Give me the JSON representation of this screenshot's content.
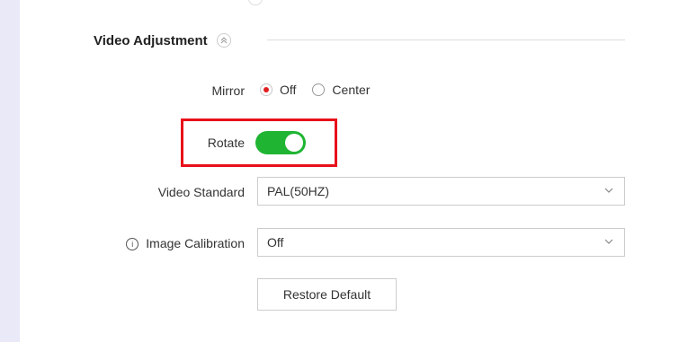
{
  "section": {
    "title": "Video Adjustment"
  },
  "mirror": {
    "label": "Mirror",
    "options": [
      {
        "label": "Off",
        "checked": true
      },
      {
        "label": "Center",
        "checked": false
      }
    ]
  },
  "rotate": {
    "label": "Rotate",
    "enabled": true,
    "on_color": "#1fb533"
  },
  "video_standard": {
    "label": "Video Standard",
    "value": "PAL(50HZ)"
  },
  "image_calibration": {
    "label": "Image Calibration",
    "value": "Off",
    "icon": "info-icon"
  },
  "restore_default": {
    "label": "Restore Default"
  },
  "colors": {
    "highlight": "#e8101a",
    "radio_selected": "#e02020",
    "background": "#e9e9f8"
  }
}
